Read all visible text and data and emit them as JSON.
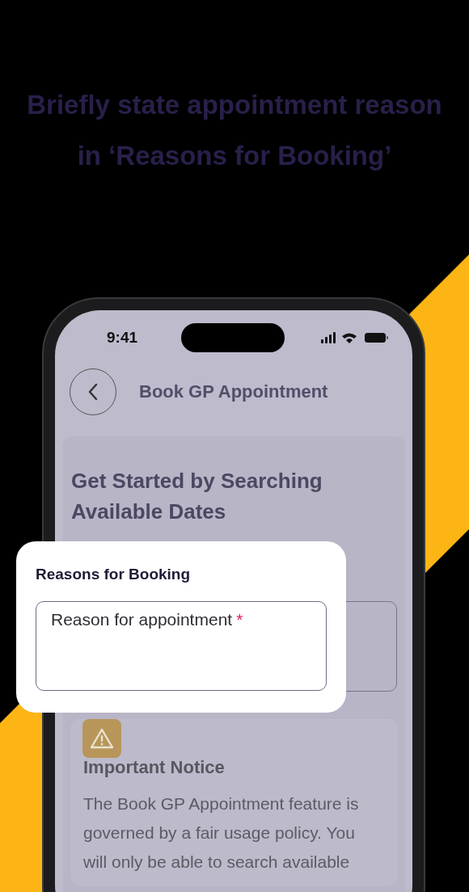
{
  "headline": "Briefly state appointment reason in ‘Reasons for Booking’",
  "status_bar": {
    "time": "9:41"
  },
  "header": {
    "title": "Book GP Appointment"
  },
  "card": {
    "heading": "Get Started by Searching Available Dates"
  },
  "notice": {
    "title": "Important Notice",
    "body": "The Book GP Appointment feature is governed by a fair usage policy. You will only be able to search available"
  },
  "popup": {
    "label": "Reasons for Booking",
    "field": {
      "placeholder": "Reason for appointment",
      "required_mark": "*"
    }
  }
}
